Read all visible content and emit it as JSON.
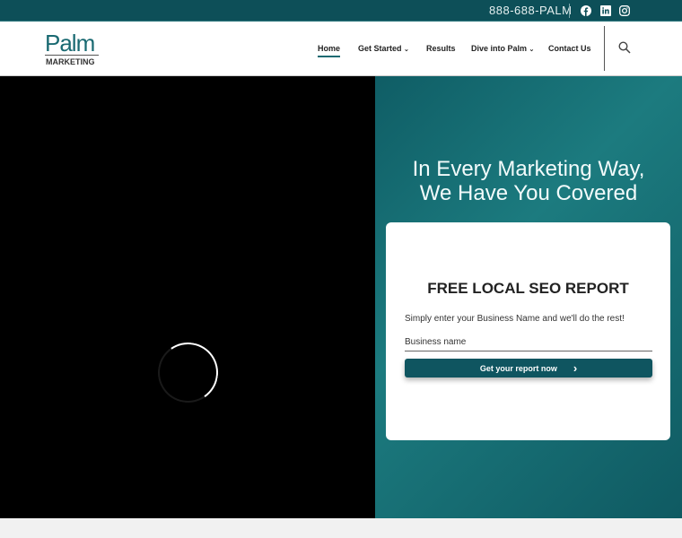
{
  "topbar": {
    "phone": "888-688-PALM"
  },
  "logo": {
    "name": "Palm",
    "tagline": "MARKETING"
  },
  "nav": [
    {
      "label": "Home"
    },
    {
      "label": "Get Started"
    },
    {
      "label": "Results"
    },
    {
      "label": "Dive into Palm"
    },
    {
      "label": "Contact Us"
    }
  ],
  "hero": {
    "headline_1": "In Every Marketing Way,",
    "headline_2": "We Have You Covered"
  },
  "form": {
    "title": "FREE LOCAL SEO REPORT",
    "subtitle": "Simply enter your Business Name and we'll do the rest!",
    "placeholder": "Business name",
    "button": "Get your report now"
  },
  "colors": {
    "brand": "#0d4f58",
    "accent": "#1a6a72"
  }
}
